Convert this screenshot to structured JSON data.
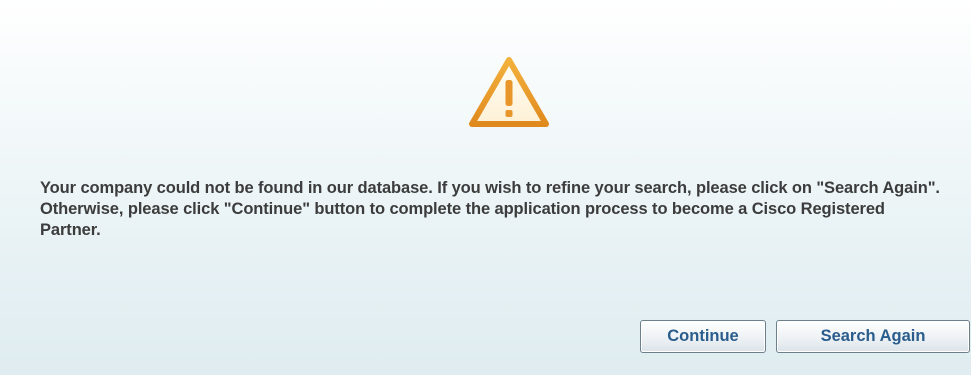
{
  "dialog": {
    "message": "Your company could not be found in our database. If you wish to refine your search, please click on \"Search Again\". Otherwise, please click \"Continue\" button to complete the application process to become a Cisco Registered Partner.",
    "icon": "warning-triangle-icon",
    "icon_color": "#f0a830"
  },
  "buttons": {
    "continue_label": "Continue",
    "search_again_label": "Search Again"
  }
}
